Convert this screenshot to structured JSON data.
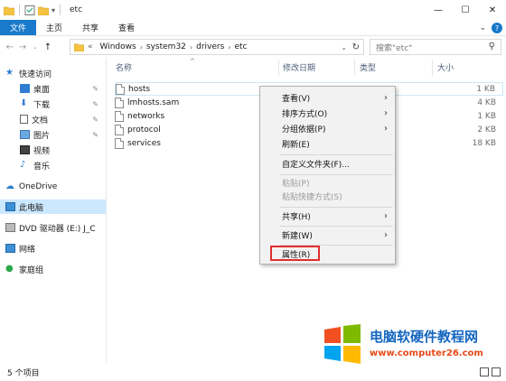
{
  "window": {
    "title": "etc",
    "minimize": "—",
    "maximize": "☐",
    "close": "✕"
  },
  "ribbon": {
    "tabs": [
      "文件",
      "主页",
      "共享",
      "查看"
    ]
  },
  "address": {
    "prefix": "«",
    "segments": [
      "Windows",
      "system32",
      "drivers",
      "etc"
    ],
    "search_placeholder": "搜索\"etc\""
  },
  "nav": {
    "items": [
      {
        "label": "快速访问",
        "pinned": false
      },
      {
        "label": "桌面",
        "pinned": true
      },
      {
        "label": "下载",
        "pinned": true
      },
      {
        "label": "文档",
        "pinned": true
      },
      {
        "label": "图片",
        "pinned": true
      },
      {
        "label": "视频",
        "pinned": false
      },
      {
        "label": "音乐",
        "pinned": false
      },
      {
        "label": "OneDrive",
        "pinned": false
      },
      {
        "label": "此电脑",
        "pinned": false
      },
      {
        "label": "DVD 驱动器 (E:) J_C",
        "pinned": false
      },
      {
        "label": "网络",
        "pinned": false
      },
      {
        "label": "家庭组",
        "pinned": false
      }
    ]
  },
  "columns": {
    "name": "名称",
    "date": "修改日期",
    "type": "类型",
    "size": "大小"
  },
  "files": [
    {
      "name": "hosts",
      "size": "1 KB"
    },
    {
      "name": "lmhosts.sam",
      "size": "4 KB"
    },
    {
      "name": "networks",
      "size": "1 KB"
    },
    {
      "name": "protocol",
      "size": "2 KB"
    },
    {
      "name": "services",
      "size": "18 KB"
    }
  ],
  "context_menu": {
    "view": "查看(V)",
    "sort": "排序方式(O)",
    "group": "分组依据(P)",
    "refresh": "刷新(E)",
    "customize": "自定义文件夹(F)...",
    "paste": "粘贴(P)",
    "paste_shortcut": "粘贴快捷方式(S)",
    "share": "共享(H)",
    "new": "新建(W)",
    "properties": "属性(R)"
  },
  "status": {
    "count": "5 个项目"
  },
  "watermark": {
    "title": "电脑软硬件教程网",
    "url": "www.computer26.com"
  },
  "colors": {
    "accent": "#1979ca",
    "selection": "#cce8ff",
    "highlight_box": "#e02e2e"
  }
}
